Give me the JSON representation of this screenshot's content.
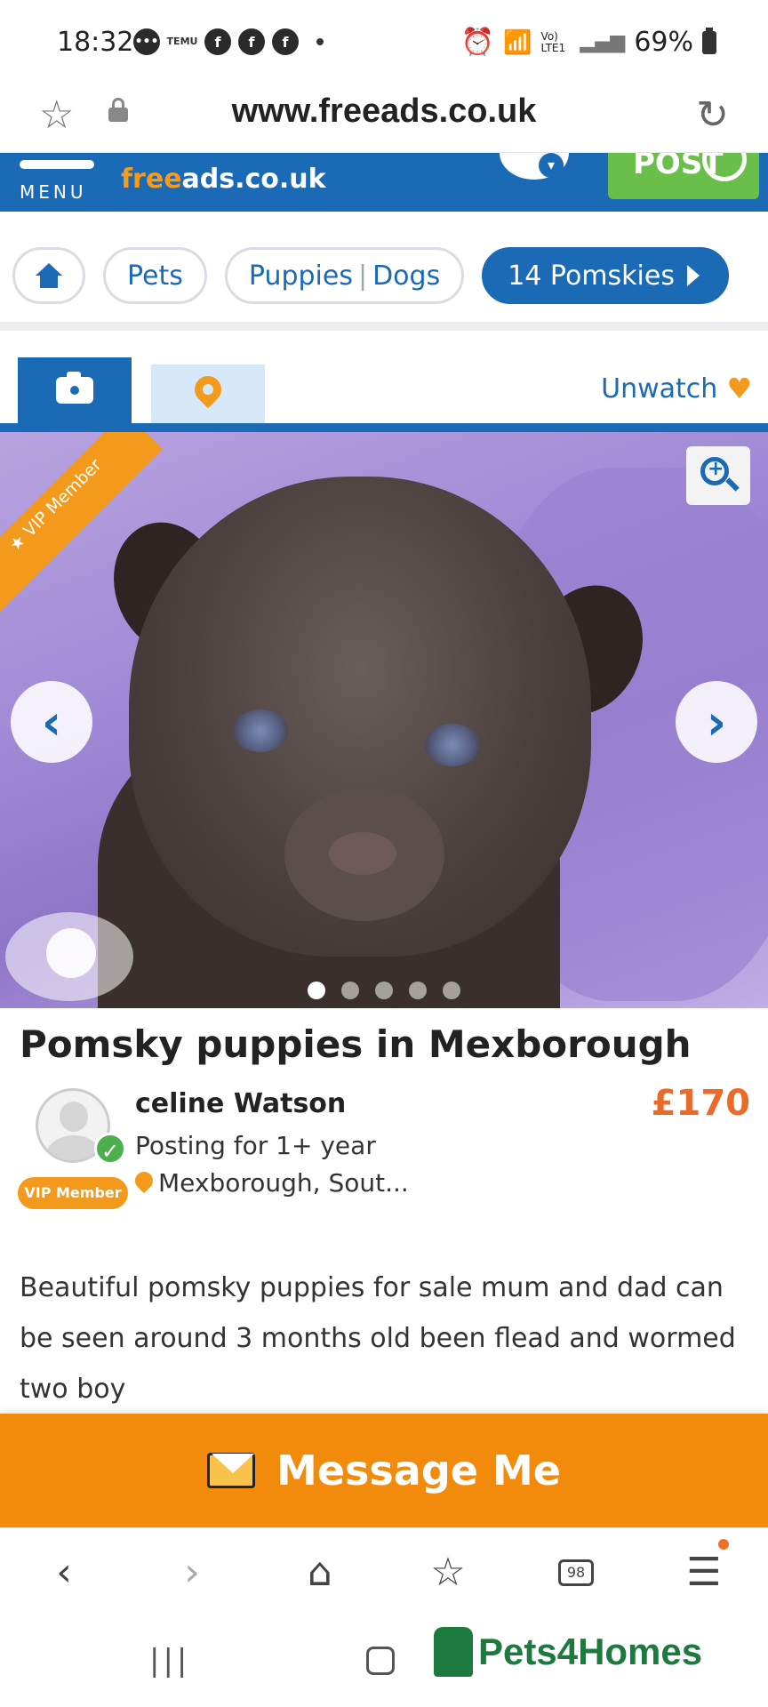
{
  "status_bar": {
    "time": "18:32",
    "notifications": [
      "chat-icon",
      "temu-icon",
      "facebook-icon",
      "facebook-icon",
      "facebook-icon"
    ],
    "temu_label": "TEMU",
    "network": "Vo) LTE1",
    "battery": "69%"
  },
  "browser": {
    "url": "www.freeads.co.uk"
  },
  "site_header": {
    "menu_label": "MENU",
    "brand_free": "free",
    "brand_rest": "ads.co.uk",
    "post_label": "POST"
  },
  "breadcrumbs": {
    "pets": "Pets",
    "puppies": "Puppies",
    "dogs": "Dogs",
    "active": "14 Pomskies"
  },
  "media": {
    "watch_label": "Unwatch",
    "vip_ribbon": "★ VIP Member",
    "photo_count": 5,
    "current_photo": 1
  },
  "listing": {
    "title": "Pomsky puppies in Mexborough",
    "seller_name": "celine Watson",
    "seller_tenure": "Posting for 1+ year",
    "seller_location": "Mexborough, Sout...",
    "vip_badge": "VIP Member",
    "price": "£170",
    "description": "Beautiful pomsky puppies for sale mum and dad can be seen around 3 months old been flead and wormed two boy"
  },
  "cta": {
    "label": "Message Me"
  },
  "browser_nav": {
    "tabs_count": "98"
  },
  "watermark": {
    "text": "Pets4Homes"
  },
  "colors": {
    "brand_blue": "#1b6ab5",
    "brand_orange": "#f28a0c",
    "price_orange": "#ea6a2a",
    "post_green": "#6abf4b"
  }
}
